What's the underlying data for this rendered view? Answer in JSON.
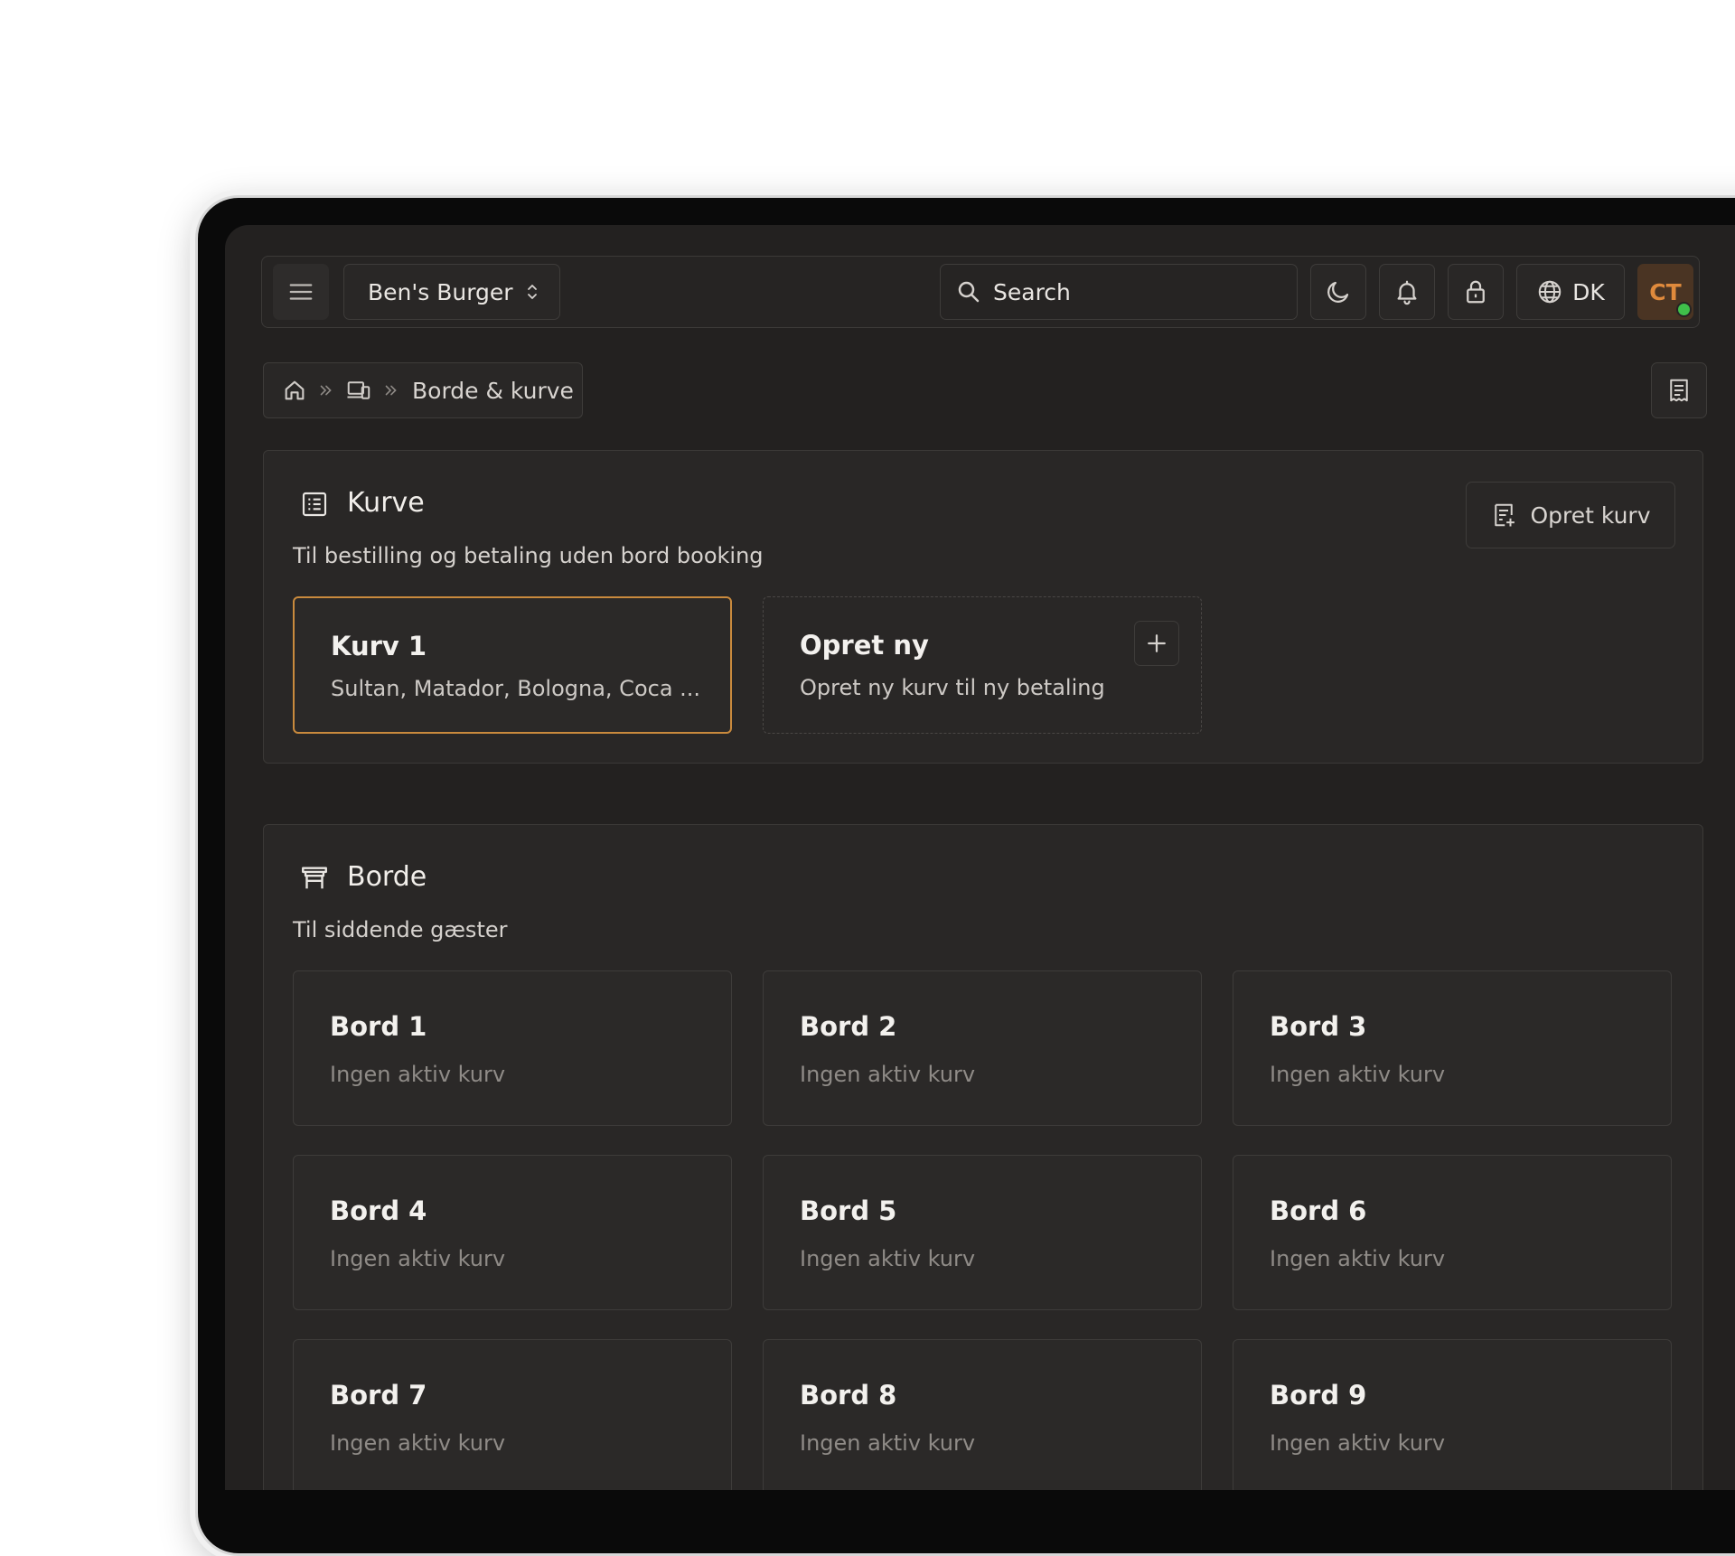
{
  "header": {
    "restaurant": "Ben's Burger",
    "search_placeholder": "Search",
    "language": "DK",
    "avatar_initials": "CT"
  },
  "breadcrumb": {
    "current": "Borde & kurve"
  },
  "kurve": {
    "title": "Kurve",
    "subtitle": "Til bestilling og betaling uden bord booking",
    "create_button": "Opret kurv",
    "cards": [
      {
        "title": "Kurv 1",
        "sub": "Sultan, Matador, Bologna, Coca ..."
      },
      {
        "title": "Opret ny",
        "sub": "Opret ny kurv til ny betaling"
      }
    ]
  },
  "borde": {
    "title": "Borde",
    "subtitle": "Til siddende gæster",
    "tables": [
      {
        "title": "Bord 1",
        "sub": "Ingen aktiv kurv"
      },
      {
        "title": "Bord 2",
        "sub": "Ingen aktiv kurv"
      },
      {
        "title": "Bord 3",
        "sub": "Ingen aktiv kurv"
      },
      {
        "title": "Bord 4",
        "sub": "Ingen aktiv kurv"
      },
      {
        "title": "Bord 5",
        "sub": "Ingen aktiv kurv"
      },
      {
        "title": "Bord 6",
        "sub": "Ingen aktiv kurv"
      },
      {
        "title": "Bord 7",
        "sub": "Ingen aktiv kurv"
      },
      {
        "title": "Bord 8",
        "sub": "Ingen aktiv kurv"
      },
      {
        "title": "Bord 9",
        "sub": "Ingen aktiv kurv"
      }
    ]
  },
  "colors": {
    "accent": "#c98a3d",
    "online": "#3fbf4a",
    "avatar_bg": "#4a3423",
    "avatar_text": "#e08a3c"
  },
  "icons": [
    "menu-icon",
    "chevron-updown-icon",
    "search-icon",
    "moon-icon",
    "bell-icon",
    "lock-icon",
    "globe-icon",
    "home-icon",
    "devices-icon",
    "double-chevron-right-icon",
    "receipt-icon",
    "list-icon",
    "receipt-add-icon",
    "plus-icon",
    "table-icon"
  ]
}
